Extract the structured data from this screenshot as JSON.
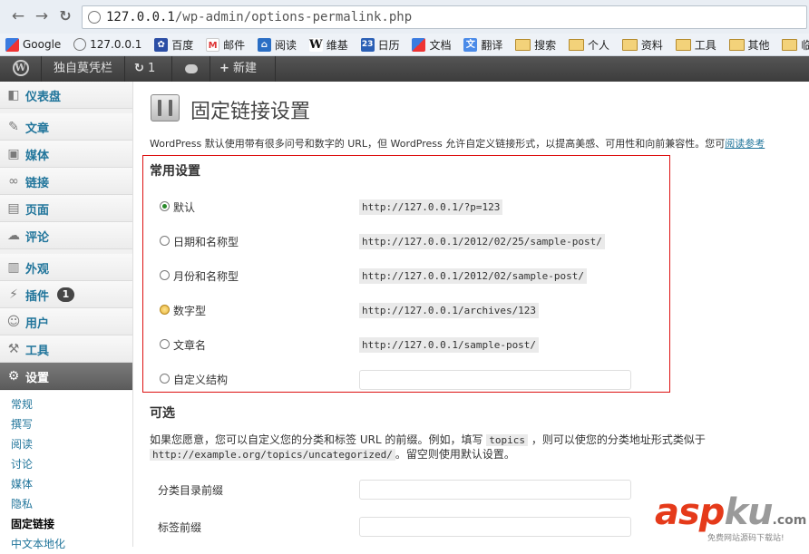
{
  "browser": {
    "url_host": "127.0.0.1",
    "url_path": "/wp-admin/options-permalink.php",
    "bookmarks": [
      {
        "label": "Google",
        "icon": "google-icon",
        "type": "site"
      },
      {
        "label": "127.0.0.1",
        "icon": "globe-icon",
        "type": "site"
      },
      {
        "label": "百度",
        "icon": "baidu-icon",
        "type": "site"
      },
      {
        "label": "邮件",
        "icon": "gmail-icon",
        "type": "site"
      },
      {
        "label": "阅读",
        "icon": "reader-icon",
        "type": "site"
      },
      {
        "label": "维基",
        "icon": "wikipedia-icon",
        "type": "site"
      },
      {
        "label": "日历",
        "icon": "calendar-icon",
        "type": "site"
      },
      {
        "label": "文档",
        "icon": "docs-icon",
        "type": "site"
      },
      {
        "label": "翻译",
        "icon": "translate-icon",
        "type": "site"
      },
      {
        "label": "搜索",
        "icon": "folder-icon",
        "type": "folder"
      },
      {
        "label": "个人",
        "icon": "folder-icon",
        "type": "folder"
      },
      {
        "label": "资料",
        "icon": "folder-icon",
        "type": "folder"
      },
      {
        "label": "工具",
        "icon": "folder-icon",
        "type": "folder"
      },
      {
        "label": "其他",
        "icon": "folder-icon",
        "type": "folder"
      },
      {
        "label": "临时",
        "icon": "folder-icon",
        "type": "folder"
      }
    ]
  },
  "adminbar": {
    "site_name": "独自莫凭栏",
    "updates_count": "1",
    "new_label": "新建"
  },
  "sidebar": {
    "items": [
      {
        "label": "仪表盘",
        "icon": "dashboard-icon"
      },
      {
        "label": "文章",
        "icon": "pin-icon"
      },
      {
        "label": "媒体",
        "icon": "media-icon"
      },
      {
        "label": "链接",
        "icon": "link-icon"
      },
      {
        "label": "页面",
        "icon": "page-icon"
      },
      {
        "label": "评论",
        "icon": "comment-icon"
      },
      {
        "label": "外观",
        "icon": "appearance-icon"
      },
      {
        "label": "插件",
        "icon": "plugin-icon",
        "badge": "1"
      },
      {
        "label": "用户",
        "icon": "users-icon"
      },
      {
        "label": "工具",
        "icon": "tools-icon"
      },
      {
        "label": "设置",
        "icon": "settings-icon"
      }
    ],
    "submenu": [
      "常规",
      "撰写",
      "阅读",
      "讨论",
      "媒体",
      "隐私",
      "固定链接",
      "中文本地化"
    ]
  },
  "main": {
    "title": "固定链接设置",
    "intro_text": "WordPress 默认使用带有很多问号和数字的 URL，但 WordPress 允许自定义链接形式，以提高美感、可用性和向前兼容性。您可",
    "intro_link": "阅读参考",
    "common": {
      "heading": "常用设置",
      "options": [
        {
          "label": "默认",
          "example": "http://127.0.0.1/?p=123",
          "checked": true
        },
        {
          "label": "日期和名称型",
          "example": "http://127.0.0.1/2012/02/25/sample-post/",
          "checked": false
        },
        {
          "label": "月份和名称型",
          "example": "http://127.0.0.1/2012/02/sample-post/",
          "checked": false
        },
        {
          "label": "数字型",
          "example": "http://127.0.0.1/archives/123",
          "checked": false
        },
        {
          "label": "文章名",
          "example": "http://127.0.0.1/sample-post/",
          "checked": false
        },
        {
          "label": "自定义结构",
          "example": "",
          "checked": false
        }
      ]
    },
    "optional": {
      "heading": "可选",
      "desc_a": "如果您愿意，您可以自定义您的分类和标签 URL 的前缀。例如，填写",
      "desc_code": "topics",
      "desc_b": "，则可以使您的分类地址形式类似于",
      "desc_url": "http://example.org/topics/uncategorized/",
      "desc_c": "。留空则使用默认设置。",
      "category_base_label": "分类目录前缀",
      "tag_base_label": "标签前缀"
    }
  },
  "watermark": {
    "brand_a": "asp",
    "brand_b": "ku",
    "brand_c": ".com",
    "tagline": "免费网站源码下载站!"
  }
}
